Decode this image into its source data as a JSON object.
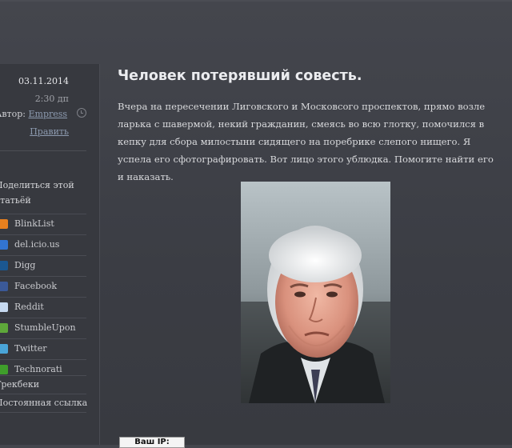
{
  "post": {
    "date": "03.11.2014",
    "time": "2:30 дп",
    "author_label": "Автор:",
    "author_name": "Empress",
    "edit_label": "Править",
    "title": "Человек потерявший совесть.",
    "body": "Вчера на пересечении Лиговского и Московсого проспектов, прямо возле ларька с шавермой, некий гражданин, смеясь во всю глотку, помочился в кепку для сбора милостыни сидящего на поребрике слепого нищего. Я успела его сфотографировать. Вот лицо этого ублюдка. Помогите найти его и наказать."
  },
  "share": {
    "title": "Поделиться этой статьёй",
    "items": [
      {
        "label": "BlinkList",
        "icon": "blinklist-icon",
        "color": "#e8801e"
      },
      {
        "label": "del.icio.us",
        "icon": "delicious-icon",
        "color": "#3274d1"
      },
      {
        "label": "Digg",
        "icon": "digg-icon",
        "color": "#1b5790"
      },
      {
        "label": "Facebook",
        "icon": "facebook-icon",
        "color": "#3b5998"
      },
      {
        "label": "Reddit",
        "icon": "reddit-icon",
        "color": "#c6d9f0"
      },
      {
        "label": "StumbleUpon",
        "icon": "stumbleupon-icon",
        "color": "#5ea83a"
      },
      {
        "label": "Twitter",
        "icon": "twitter-icon",
        "color": "#4aa5d8"
      },
      {
        "label": "Technorati",
        "icon": "technorati-icon",
        "color": "#3f9e2b"
      }
    ]
  },
  "links": {
    "trackbacks": "Трекбеки",
    "permalink": "Постоянная ссылка"
  },
  "ip_widget": {
    "label": "Ваш IP:"
  }
}
